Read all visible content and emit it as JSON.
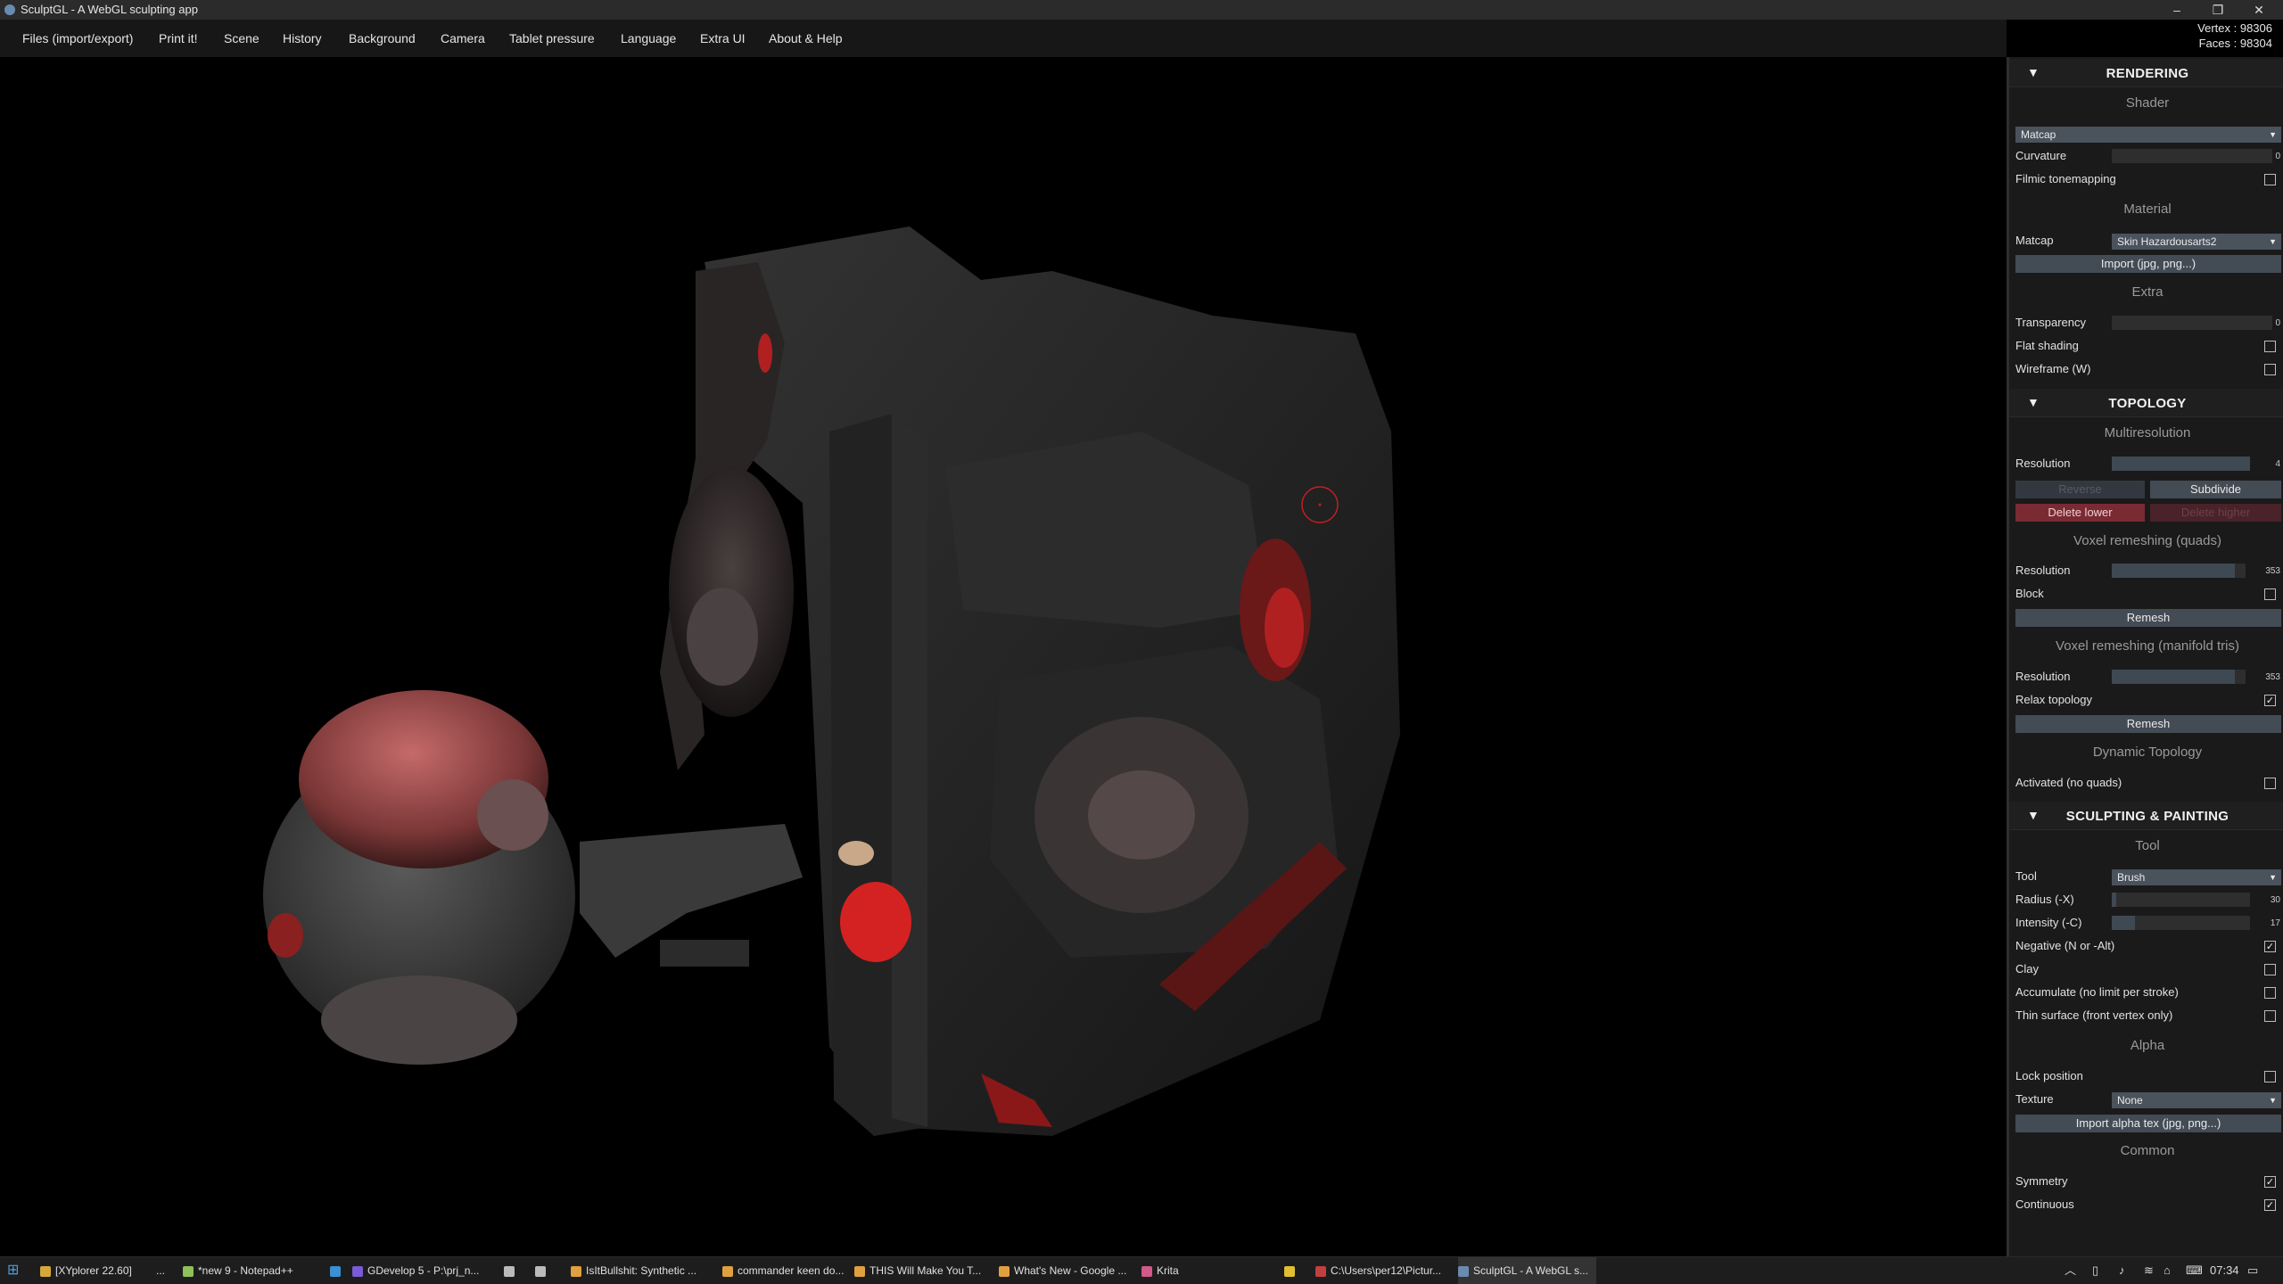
{
  "window": {
    "title": "SculptGL - A WebGL sculpting app",
    "controls": [
      "–",
      "❐",
      "✕"
    ]
  },
  "stats": {
    "vertex": "Vertex : 98306",
    "faces": "Faces : 98304"
  },
  "menu": [
    "Files (import/export)",
    "Print it!",
    "Scene",
    "History",
    "Background",
    "Camera",
    "Tablet pressure",
    "Language",
    "Extra UI",
    "About & Help"
  ],
  "panel": {
    "rendering": {
      "header": "RENDERING",
      "shader_title": "Shader",
      "shader_value": "Matcap",
      "curvature_label": "Curvature",
      "curvature_value": "0",
      "curvature_level": 0,
      "filmic_label": "Filmic tonemapping",
      "filmic_checked": false,
      "material_title": "Material",
      "matcap_label": "Matcap",
      "matcap_value": "Skin Hazardousarts2",
      "import_label": "Import (jpg, png...)",
      "extra_title": "Extra",
      "transparency_label": "Transparency",
      "transparency_value": "0",
      "transparency_level": 0,
      "flat_label": "Flat shading",
      "flat_checked": false,
      "wireframe_label": "Wireframe (W)",
      "wireframe_checked": false
    },
    "topology": {
      "header": "TOPOLOGY",
      "multires_title": "Multiresolution",
      "resolution_label": "Resolution",
      "resolution_value": "4",
      "resolution_level": 1.0,
      "reverse_label": "Reverse",
      "subdivide_label": "Subdivide",
      "delete_lower_label": "Delete lower",
      "delete_higher_label": "Delete higher",
      "voxel_quads_title": "Voxel remeshing (quads)",
      "vq_resolution_label": "Resolution",
      "vq_resolution_value": "353",
      "vq_resolution_level": 0.92,
      "block_label": "Block",
      "block_checked": false,
      "remesh_label": "Remesh",
      "voxel_tris_title": "Voxel remeshing (manifold tris)",
      "vt_resolution_label": "Resolution",
      "vt_resolution_value": "353",
      "vt_resolution_level": 0.92,
      "relax_label": "Relax topology",
      "relax_checked": true,
      "remesh2_label": "Remesh",
      "dyntopo_title": "Dynamic Topology",
      "activated_label": "Activated (no quads)",
      "activated_checked": false
    },
    "sculpting": {
      "header": "SCULPTING & PAINTING",
      "tool_title": "Tool",
      "tool_label": "Tool",
      "tool_value": "Brush",
      "radius_label": "Radius (-X)",
      "radius_value": "30",
      "radius_level": 0.03,
      "intensity_label": "Intensity (-C)",
      "intensity_value": "17",
      "intensity_level": 0.17,
      "negative_label": "Negative (N or -Alt)",
      "negative_checked": true,
      "clay_label": "Clay",
      "clay_checked": false,
      "accumulate_label": "Accumulate (no limit per stroke)",
      "accumulate_checked": false,
      "thin_label": "Thin surface (front vertex only)",
      "thin_checked": false,
      "alpha_title": "Alpha",
      "lock_label": "Lock position",
      "lock_checked": false,
      "texture_label": "Texture",
      "texture_value": "None",
      "import_alpha_label": "Import alpha tex (jpg, png...)",
      "common_title": "Common",
      "symmetry_label": "Symmetry",
      "symmetry_checked": true,
      "continuous_label": "Continuous",
      "continuous_checked": true
    }
  },
  "taskbar": {
    "items": [
      {
        "label": "[XYplorer 22.60]",
        "color": "#d6a83a"
      },
      {
        "label": "...",
        "color": ""
      },
      {
        "label": "*new 9 - Notepad++",
        "color": "#8fbf5a"
      },
      {
        "label": "",
        "color": "#3b8fd6"
      },
      {
        "label": "GDevelop 5 - P:\\prj_n...",
        "color": "#7a5ad6"
      },
      {
        "label": "",
        "color": "#bbbbbb"
      },
      {
        "label": "",
        "color": "#bbbbbb"
      },
      {
        "label": "IsItBullshit: Synthetic ...",
        "color": "#e0a040"
      },
      {
        "label": "commander keen do...",
        "color": "#e0a040"
      },
      {
        "label": "THIS Will Make You T...",
        "color": "#e0a040"
      },
      {
        "label": "What's New - Google ...",
        "color": "#e0a040"
      },
      {
        "label": "Krita",
        "color": "#d05a8a"
      },
      {
        "label": "",
        "color": "#e0c030"
      },
      {
        "label": "C:\\Users\\per12\\Pictur...",
        "color": "#c04040"
      },
      {
        "label": "SculptGL - A WebGL s...",
        "color": "#6a8bb0"
      }
    ],
    "time": "07:34"
  }
}
